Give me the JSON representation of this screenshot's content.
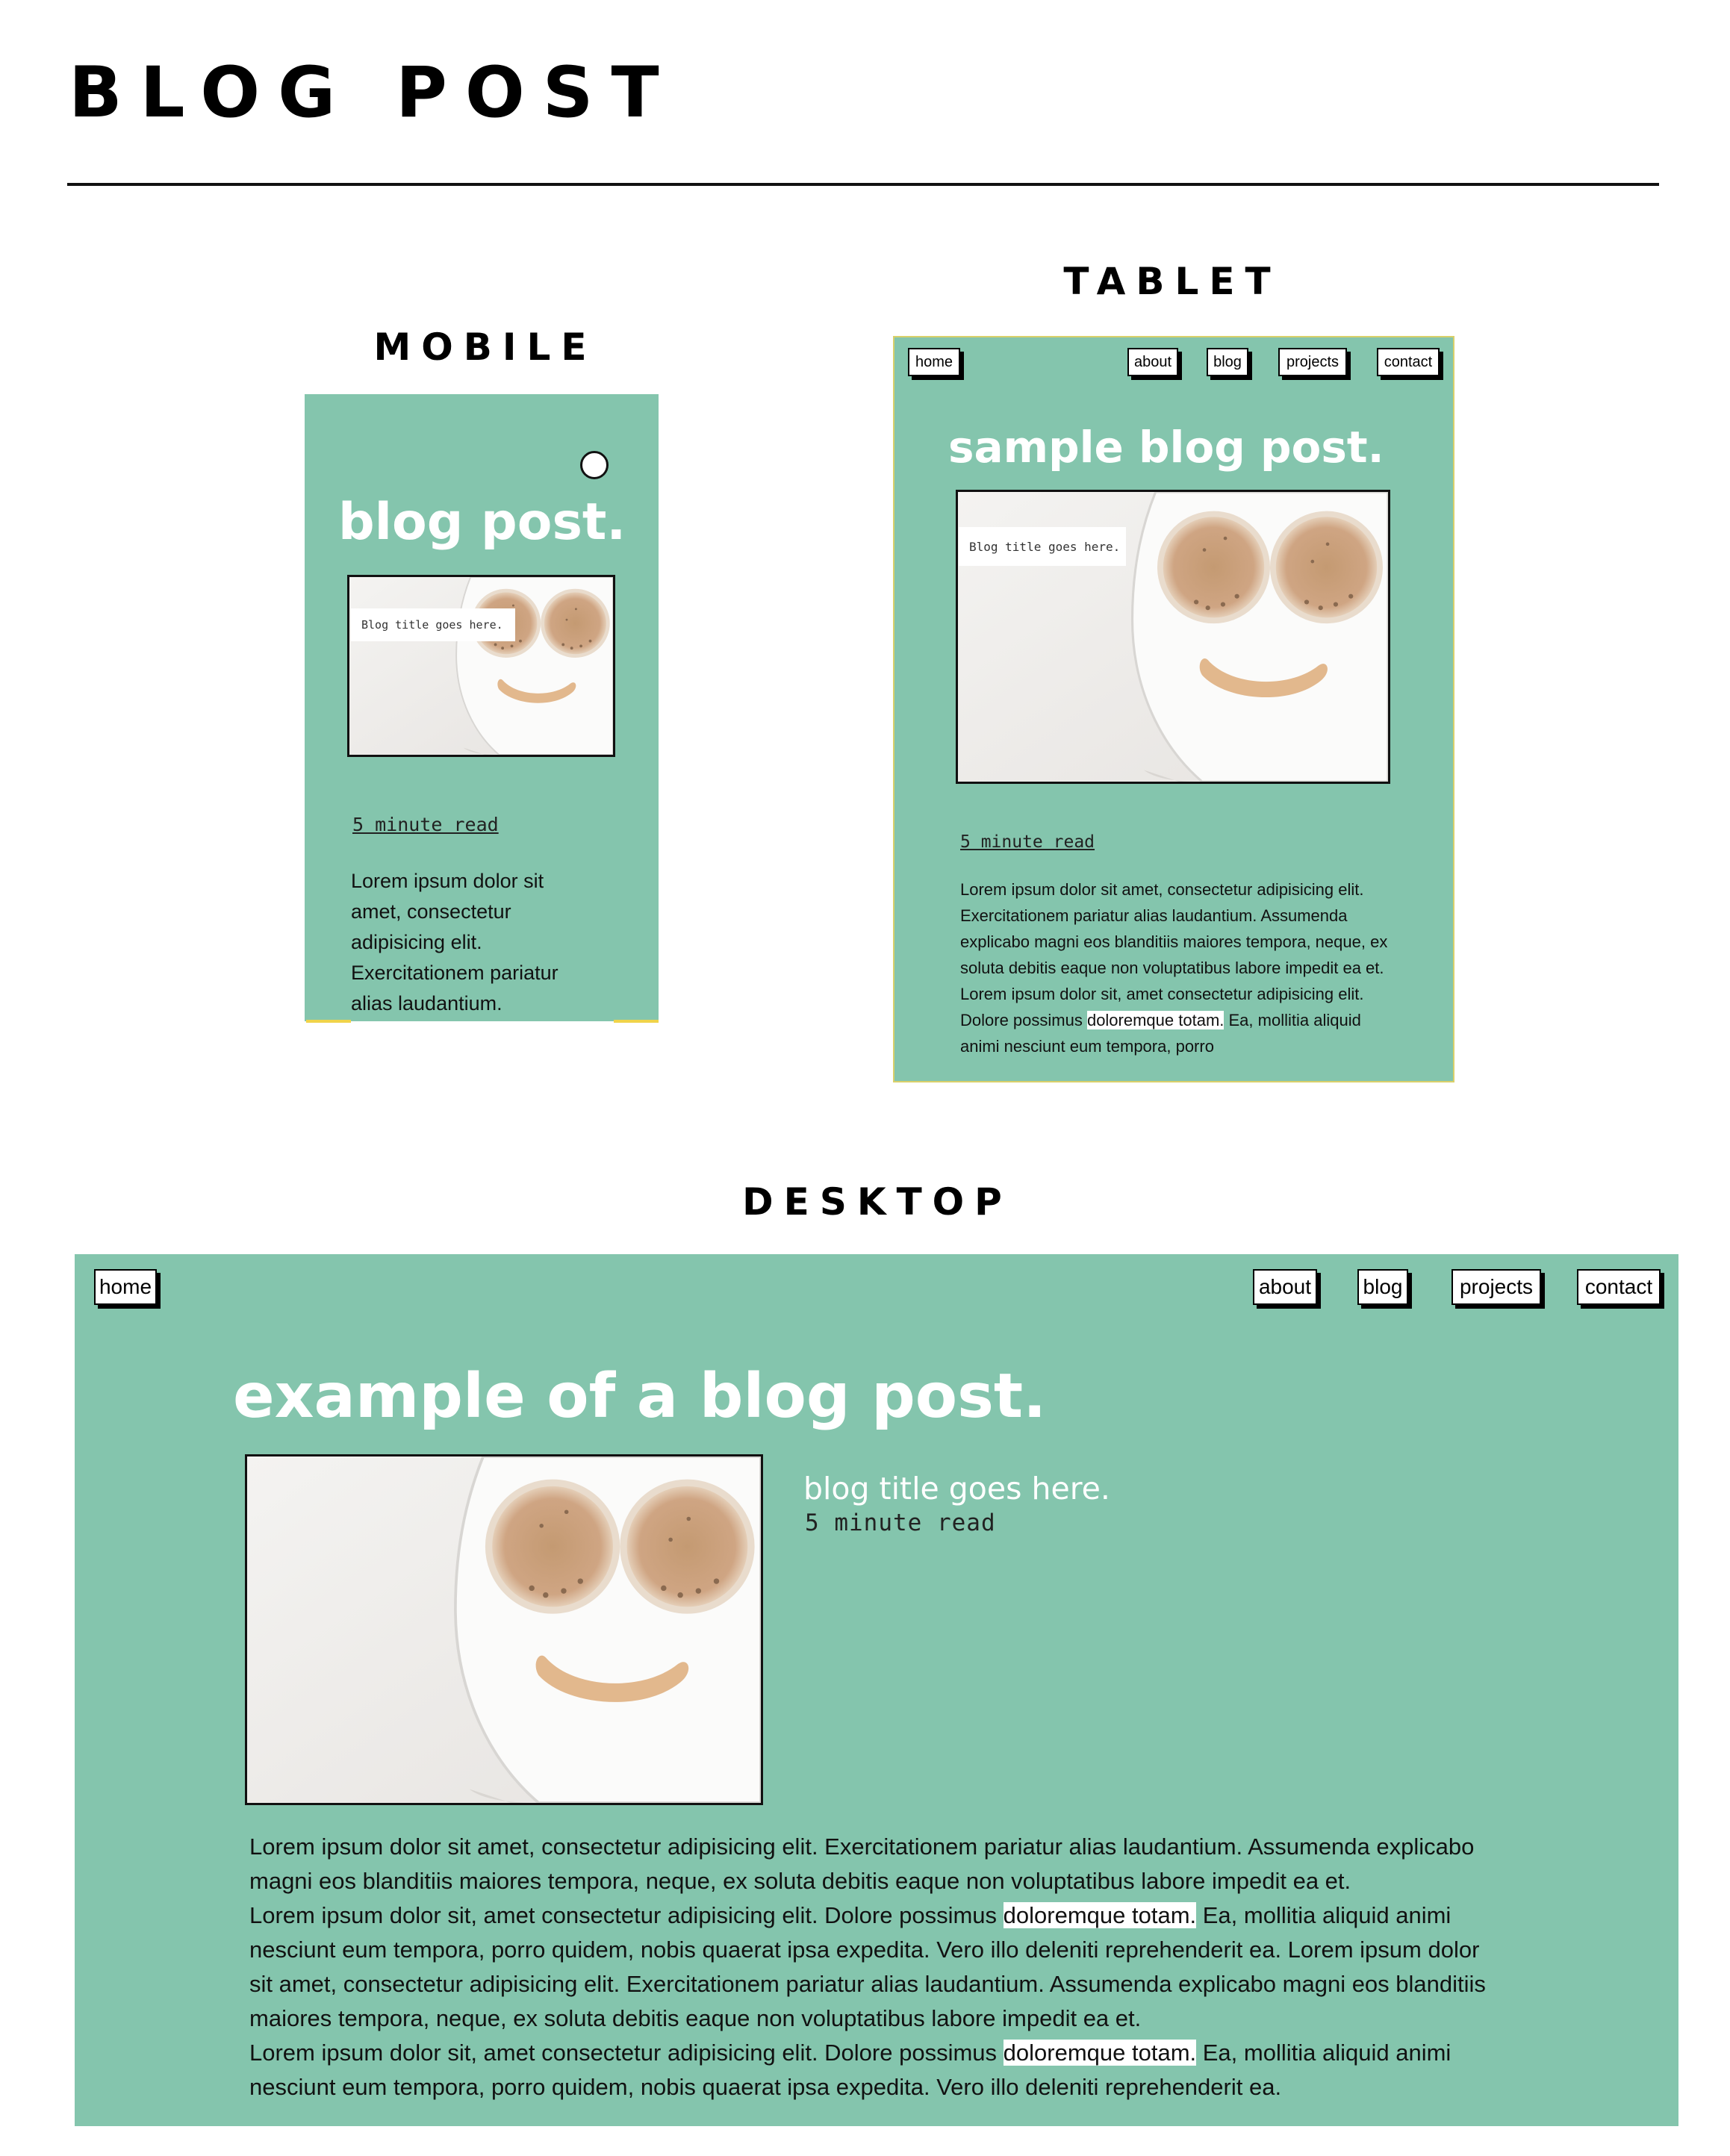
{
  "page": {
    "title": "BLOG POST"
  },
  "mobile": {
    "label": "MOBILE",
    "hero": "blog post.",
    "caption": "Blog title goes here.",
    "read_time": "5 minute read",
    "body": "Lorem ipsum dolor sit amet, consectetur adipisicing elit. Exercitationem pariatur alias laudantium."
  },
  "tablet": {
    "label": "TABLET",
    "nav": {
      "home": "home",
      "about": "about",
      "blog": "blog",
      "projects": "projects",
      "contact": "contact"
    },
    "hero": "sample blog post.",
    "caption": "Blog title goes here.",
    "read_time": "5 minute read",
    "p1": "Lorem ipsum dolor sit amet, consectetur adipisicing elit. Exercitationem pariatur alias laudantium. Assumenda explicabo magni eos blanditiis maiores tempora, neque, ex soluta debitis eaque non voluptatibus labore impedit ea et.",
    "p2_before": "Lorem ipsum dolor sit, amet consectetur adipisicing elit. Dolore possimus ",
    "p2_highlight": "doloremque totam.",
    "p2_after": " Ea, mollitia aliquid animi nesciunt eum tempora, porro"
  },
  "desktop": {
    "label": "DESKTOP",
    "nav": {
      "home": "home",
      "about": "about",
      "blog": "blog",
      "projects": "projects",
      "contact": "contact"
    },
    "hero": "example of a blog post.",
    "blog_title": "blog title goes here.",
    "read_time": "5 minute read",
    "p1": "Lorem ipsum dolor sit amet, consectetur adipisicing elit. Exercitationem pariatur alias laudantium. Assumenda explicabo magni eos blanditiis maiores tempora, neque, ex soluta debitis eaque non voluptatibus labore impedit ea et.",
    "p2_before": "Lorem ipsum dolor sit, amet consectetur adipisicing elit. Dolore possimus ",
    "p2_highlight": "doloremque totam.",
    "p2_after": " Ea, mollitia aliquid animi nesciunt eum tempora, porro quidem, nobis quaerat ipsa expedita. Vero illo deleniti reprehenderit ea. Lorem ipsum dolor sit amet, consectetur adipisicing elit. Exercitationem pariatur alias laudantium. Assumenda explicabo magni eos blanditiis maiores tempora, neque, ex soluta debitis eaque non voluptatibus labore impedit ea et.",
    "p3_before": "Lorem ipsum dolor sit, amet consectetur adipisicing elit. Dolore possimus ",
    "p3_highlight": "doloremque totam.",
    "p3_after": " Ea, mollitia aliquid animi nesciunt eum tempora, porro quidem, nobis quaerat ipsa expedita. Vero illo deleniti reprehenderit ea."
  },
  "colors": {
    "frame_bg": "#84c5ad",
    "text": "#111111"
  }
}
